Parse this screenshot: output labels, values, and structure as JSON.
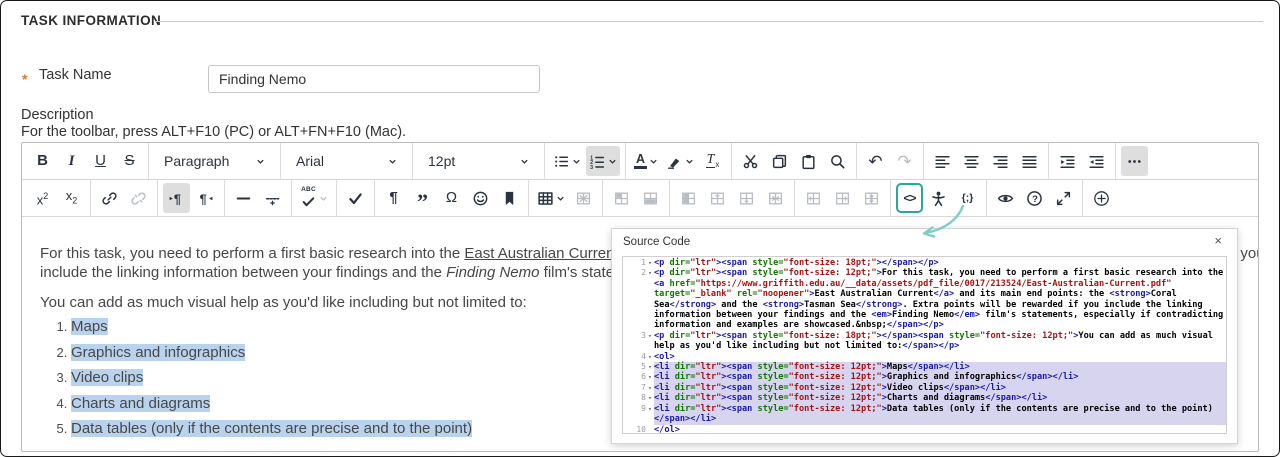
{
  "page": {
    "title": "TASK INFORMATION"
  },
  "task_name": {
    "required_marker": "*",
    "label": "Task Name",
    "value": "Finding Nemo"
  },
  "description": {
    "label": "Description",
    "toolbar_hint": "For the toolbar, press ALT+F10 (PC) or ALT+FN+F10 (Mac)."
  },
  "toolbar": {
    "row1": [
      {
        "buttons": [
          {
            "name": "bold",
            "icon": "bold"
          },
          {
            "name": "italic",
            "icon": "italic"
          },
          {
            "name": "underline",
            "icon": "underline"
          },
          {
            "name": "strikethrough",
            "icon": "strikethrough"
          }
        ]
      },
      {
        "buttons": [
          {
            "name": "block-format-select",
            "select": true,
            "label": "Paragraph"
          }
        ]
      },
      {
        "buttons": [
          {
            "name": "font-family-select",
            "select": true,
            "label": "Arial"
          }
        ]
      },
      {
        "buttons": [
          {
            "name": "font-size-select",
            "select": true,
            "label": "12pt"
          }
        ]
      },
      {
        "buttons": [
          {
            "name": "bullet-list",
            "icon": "bullet-list",
            "chevron": true
          },
          {
            "name": "numbered-list",
            "icon": "numbered-list",
            "chevron": true,
            "active": true
          }
        ]
      },
      {
        "buttons": [
          {
            "name": "text-color",
            "icon": "text-color",
            "chevron": true
          },
          {
            "name": "highlight-color",
            "icon": "highlight",
            "chevron": true
          },
          {
            "name": "clear-formatting",
            "icon": "clear-format"
          }
        ]
      },
      {
        "buttons": [
          {
            "name": "cut",
            "icon": "cut"
          },
          {
            "name": "copy",
            "icon": "copy"
          },
          {
            "name": "paste",
            "icon": "paste"
          },
          {
            "name": "search",
            "icon": "search"
          }
        ]
      },
      {
        "buttons": [
          {
            "name": "undo",
            "icon": "undo"
          },
          {
            "name": "redo",
            "icon": "redo",
            "disabled": true
          }
        ]
      },
      {
        "buttons": [
          {
            "name": "align-left",
            "icon": "align-left"
          },
          {
            "name": "align-center",
            "icon": "align-center"
          },
          {
            "name": "align-right",
            "icon": "align-right"
          },
          {
            "name": "align-justify",
            "icon": "align-justify"
          }
        ]
      },
      {
        "buttons": [
          {
            "name": "indent",
            "icon": "indent"
          },
          {
            "name": "outdent",
            "icon": "outdent"
          }
        ]
      },
      {
        "buttons": [
          {
            "name": "more-options",
            "icon": "more",
            "active": true
          }
        ]
      }
    ],
    "row2": [
      {
        "buttons": [
          {
            "name": "superscript",
            "icon": "superscript"
          },
          {
            "name": "subscript",
            "icon": "subscript"
          }
        ]
      },
      {
        "buttons": [
          {
            "name": "insert-link",
            "icon": "link"
          },
          {
            "name": "remove-link",
            "icon": "unlink",
            "disabled": true
          }
        ]
      },
      {
        "buttons": [
          {
            "name": "ltr-direction",
            "icon": "ltr",
            "active": true
          },
          {
            "name": "rtl-direction",
            "icon": "rtl"
          }
        ]
      },
      {
        "buttons": [
          {
            "name": "horizontal-rule",
            "icon": "hr"
          },
          {
            "name": "page-break",
            "icon": "page-break"
          }
        ]
      },
      {
        "buttons": [
          {
            "name": "spellcheck",
            "icon": "spellcheck",
            "chevron": true,
            "chevron_muted": true
          }
        ]
      },
      {
        "buttons": [
          {
            "name": "check",
            "icon": "tick"
          }
        ]
      },
      {
        "buttons": [
          {
            "name": "show-invisibles",
            "icon": "pilcrow"
          },
          {
            "name": "blockquote",
            "icon": "quote"
          },
          {
            "name": "special-character",
            "icon": "omega"
          },
          {
            "name": "emoticon",
            "icon": "smiley"
          },
          {
            "name": "anchor",
            "icon": "bookmark"
          }
        ]
      },
      {
        "buttons": [
          {
            "name": "table",
            "icon": "table",
            "chevron": true
          },
          {
            "name": "delete-table",
            "icon": "delete-table",
            "disabled": true
          }
        ]
      },
      {
        "buttons": [
          {
            "name": "cell-properties",
            "icon": "cell-props",
            "disabled": true
          },
          {
            "name": "row-properties",
            "icon": "row-props",
            "disabled": true
          }
        ]
      },
      {
        "buttons": [
          {
            "name": "merge-cells",
            "icon": "merge-cells",
            "disabled": true
          },
          {
            "name": "insert-row-above",
            "icon": "row-above",
            "disabled": true
          },
          {
            "name": "insert-row-below",
            "icon": "row-below",
            "disabled": true
          },
          {
            "name": "delete-row",
            "icon": "delete-row",
            "disabled": true
          }
        ]
      },
      {
        "buttons": [
          {
            "name": "insert-column-before",
            "icon": "col-before",
            "disabled": true
          },
          {
            "name": "insert-column-after",
            "icon": "col-after",
            "disabled": true
          },
          {
            "name": "delete-column",
            "icon": "delete-col",
            "disabled": true
          }
        ]
      },
      {
        "buttons": [
          {
            "name": "source-code",
            "icon": "source-code",
            "accent": true
          },
          {
            "name": "accessibility-checker",
            "icon": "accessibility"
          },
          {
            "name": "code-sample",
            "icon": "code-sample"
          }
        ]
      },
      {
        "buttons": [
          {
            "name": "preview",
            "icon": "eye"
          },
          {
            "name": "help",
            "icon": "help"
          },
          {
            "name": "fullscreen",
            "icon": "fullscreen"
          }
        ]
      },
      {
        "buttons": [
          {
            "name": "add-content",
            "icon": "add"
          }
        ]
      }
    ]
  },
  "editor": {
    "blocks": [
      {
        "type": "p",
        "lines": [
          [
            {
              "t": "For this task, you need to perform a first basic research into the "
            },
            {
              "t": "East Australian Current",
              "s": "link"
            },
            {
              "t": " and its main end points: the "
            },
            {
              "t": "Coral Sea",
              "s": "b"
            },
            {
              "t": " and the "
            },
            {
              "t": "Tasman Sea",
              "s": "b"
            },
            {
              "t": ". Extra points will be rewarded if you"
            }
          ],
          [
            {
              "t": "include the linking information between your findings and the "
            },
            {
              "t": "Finding Nemo",
              "s": "i"
            },
            {
              "t": " film's statements, especially if contradicting information and examples are showcased."
            }
          ]
        ]
      },
      {
        "type": "p",
        "cls": "ed-p2",
        "lines": [
          [
            {
              "t": "You can add as much visual help as you'd like including but not limited to:"
            }
          ]
        ]
      },
      {
        "type": "ol",
        "items": [
          {
            "text": "Maps",
            "selected": true
          },
          {
            "text": "Graphics and infographics",
            "selected": true
          },
          {
            "text": "Video clips",
            "selected": true
          },
          {
            "text": "Charts and diagrams",
            "selected": true
          },
          {
            "text": "Data tables (only if the contents are precise and to the point)",
            "selected": true
          }
        ]
      }
    ]
  },
  "source_panel": {
    "title": "Source Code",
    "close_label": "×",
    "lines": [
      {
        "n": 1,
        "fold": true,
        "selected": false,
        "code": "<p dir=\"ltr\"><span style=\"font-size: 18pt;\"></span></p>"
      },
      {
        "n": 2,
        "fold": true,
        "selected": false,
        "code": "<p dir=\"ltr\"><span style=\"font-size: 12pt;\">For this task, you need to perform a first basic research into the <a href=\"https://www.griffith.edu.au/__data/assets/pdf_file/0017/213524/East-Australian-Current.pdf\" target=\"_blank\" rel=\"noopener\">East Australian Current</a> and its main end points: the <strong>Coral Sea</strong> and the <strong>Tasman Sea</strong>. Extra points will be rewarded if you include the linking information between your findings and the <em>Finding Nemo</em> film's statements, especially if contradicting information and examples are showcased.&nbsp;</span></p>"
      },
      {
        "n": 3,
        "fold": true,
        "selected": false,
        "code": "<p dir=\"ltr\"><span style=\"font-size: 18pt;\"></span><span style=\"font-size: 12pt;\">You can add as much visual help as you'd like including but not limited to:</span></p>"
      },
      {
        "n": 4,
        "fold": true,
        "selected": false,
        "code": "<ol>"
      },
      {
        "n": 5,
        "fold": true,
        "selected": true,
        "code": "<li dir=\"ltr\"><span style=\"font-size: 12pt;\">Maps</span></li>"
      },
      {
        "n": 6,
        "fold": true,
        "selected": true,
        "code": "<li dir=\"ltr\"><span style=\"font-size: 12pt;\">Graphics and infographics</span></li>"
      },
      {
        "n": 7,
        "fold": true,
        "selected": true,
        "code": "<li dir=\"ltr\"><span style=\"font-size: 12pt;\">Video clips</span></li>"
      },
      {
        "n": 8,
        "fold": true,
        "selected": true,
        "code": "<li dir=\"ltr\"><span style=\"font-size: 12pt;\">Charts and diagrams</span></li>"
      },
      {
        "n": 9,
        "fold": true,
        "selected": true,
        "code": "<li dir=\"ltr\"><span style=\"font-size: 12pt;\">Data tables (only if the contents are precise and to the point)</span></li>"
      },
      {
        "n": 10,
        "fold": false,
        "selected": false,
        "code": "</ol>"
      }
    ]
  },
  "colors": {
    "accent_teal": "#2aa79b",
    "arrow_teal": "#82cdc5",
    "selection_blue": "#b9d3ef",
    "code_selection": "#d7d4f0",
    "syntax_tag": "#1a1aa6",
    "syntax_attr": "#117700",
    "syntax_string": "#a31515",
    "asterisk_orange": "#d9782d"
  }
}
